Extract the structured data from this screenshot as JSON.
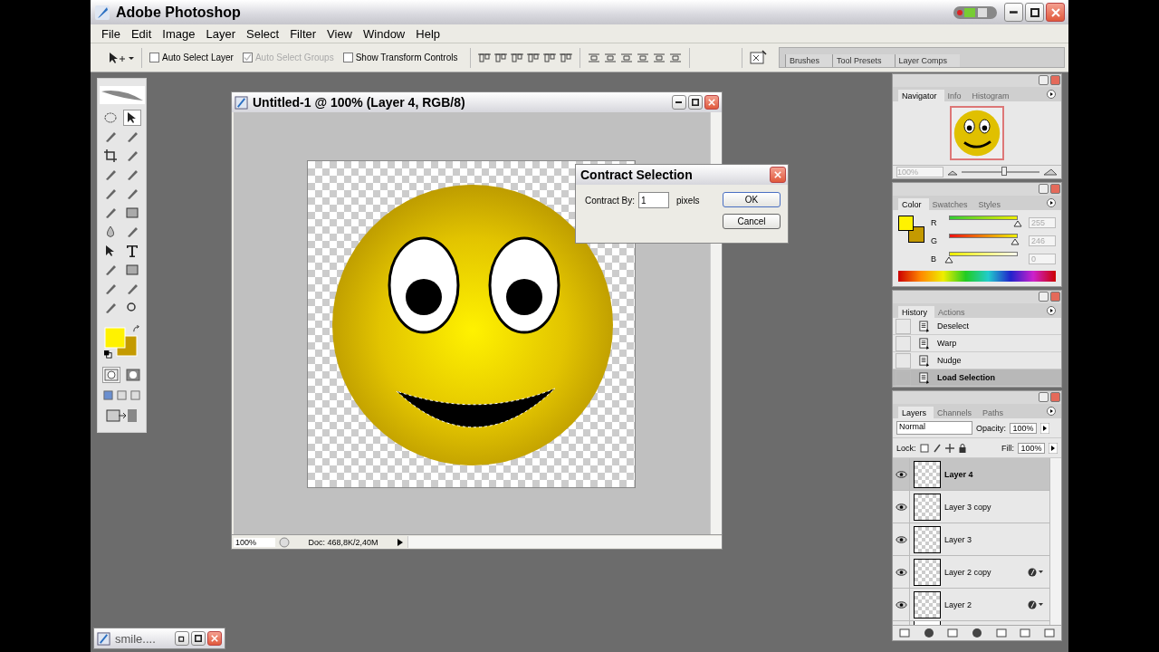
{
  "window": {
    "title": "Adobe Photoshop"
  },
  "menu": [
    "File",
    "Edit",
    "Image",
    "Layer",
    "Select",
    "Filter",
    "View",
    "Window",
    "Help"
  ],
  "options_bar": {
    "checkboxes": [
      {
        "label": "Auto Select Layer",
        "checked": false,
        "disabled": false
      },
      {
        "label": "Auto Select Groups",
        "checked": true,
        "disabled": true
      },
      {
        "label": "Show Transform Controls",
        "checked": false,
        "disabled": false
      }
    ]
  },
  "palette_well": {
    "tabs": [
      "Brushes",
      "Tool Presets",
      "Layer Comps"
    ]
  },
  "document": {
    "title": "Untitled-1 @ 100% (Layer 4, RGB/8)",
    "zoom": "100%",
    "doc_info": "Doc: 468,8K/2,40M"
  },
  "dialog": {
    "title": "Contract Selection",
    "label": "Contract By:",
    "value": "1",
    "unit": "pixels",
    "buttons": [
      "OK",
      "Cancel"
    ]
  },
  "navigator": {
    "tabs": [
      {
        "label": "Navigator",
        "selected": true
      },
      {
        "label": "Info",
        "selected": false
      },
      {
        "label": "Histogram",
        "selected": false
      }
    ],
    "zoom": "100%",
    "level": 0.55
  },
  "color": {
    "tabs": [
      {
        "label": "Color",
        "selected": true
      },
      {
        "label": "Swatches",
        "selected": false
      },
      {
        "label": "Styles",
        "selected": false
      }
    ],
    "channels": [
      {
        "name": "R",
        "value": "255",
        "level": 1.0
      },
      {
        "name": "G",
        "value": "246",
        "level": 0.96
      },
      {
        "name": "B",
        "value": "0",
        "level": 0.0
      }
    ]
  },
  "history": {
    "tabs": [
      {
        "label": "History",
        "selected": true
      },
      {
        "label": "Actions",
        "selected": false
      }
    ],
    "items": [
      {
        "label": "Deselect",
        "selected": false
      },
      {
        "label": "Warp",
        "selected": false
      },
      {
        "label": "Nudge",
        "selected": false
      },
      {
        "label": "Load Selection",
        "selected": true
      }
    ]
  },
  "layers": {
    "tabs": [
      {
        "label": "Layers",
        "selected": true
      },
      {
        "label": "Channels",
        "selected": false
      },
      {
        "label": "Paths",
        "selected": false
      }
    ],
    "blend_mode": "Normal",
    "opacity_label": "Opacity:",
    "opacity": "100%",
    "lock_label": "Lock:",
    "fill_label": "Fill:",
    "fill": "100%",
    "items": [
      {
        "name": "Layer 4",
        "selected": true,
        "visible": true,
        "effects": false
      },
      {
        "name": "Layer 3 copy",
        "selected": false,
        "visible": true,
        "effects": false
      },
      {
        "name": "Layer 3",
        "selected": false,
        "visible": true,
        "effects": false
      },
      {
        "name": "Layer 2 copy",
        "selected": false,
        "visible": true,
        "effects": true
      },
      {
        "name": "Layer 2",
        "selected": false,
        "visible": true,
        "effects": true
      }
    ]
  },
  "minimized_window": {
    "title": "smile...."
  }
}
